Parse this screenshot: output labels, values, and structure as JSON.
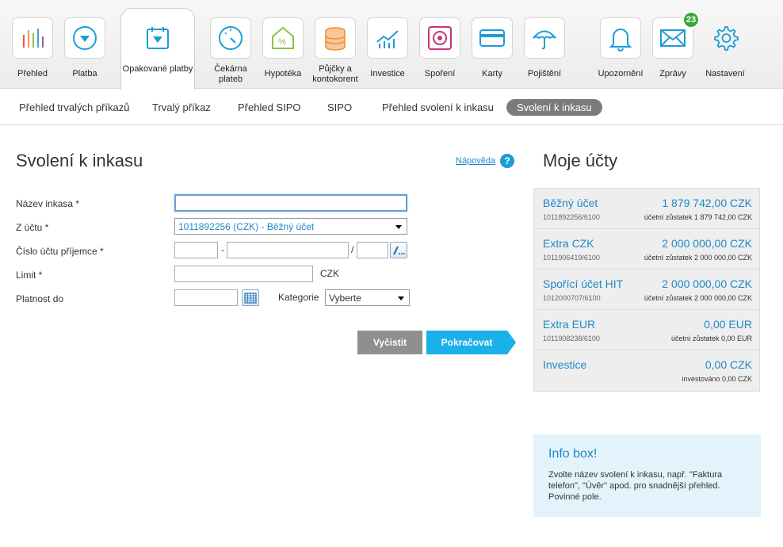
{
  "nav": {
    "items": [
      {
        "label": "Přehled",
        "icon": "bar-chart-icon"
      },
      {
        "label": "Platba",
        "icon": "payment-icon"
      },
      {
        "label": "Opakované platby",
        "icon": "recurring-payments-icon"
      },
      {
        "label": "Čekárna plateb",
        "icon": "gauge-icon"
      },
      {
        "label": "Hypotéka",
        "icon": "house-percent-icon"
      },
      {
        "label": "Půjčky a kontokorent",
        "icon": "coins-icon"
      },
      {
        "label": "Investice",
        "icon": "investment-chart-icon"
      },
      {
        "label": "Spoření",
        "icon": "safe-icon"
      },
      {
        "label": "Karty",
        "icon": "card-icon"
      },
      {
        "label": "Pojištění",
        "icon": "umbrella-icon"
      },
      {
        "label": "Upozornění",
        "icon": "bell-icon"
      },
      {
        "label": "Zprávy",
        "icon": "envelope-icon"
      },
      {
        "label": "Nastavení",
        "icon": "gear-icon"
      }
    ],
    "messages_badge": "23"
  },
  "subnav": {
    "items": [
      "Přehled trvalých příkazů",
      "Trvalý příkaz",
      "Přehled SIPO",
      "SIPO",
      "Přehled svolení k inkasu",
      "Svolení k inkasu"
    ]
  },
  "form": {
    "title": "Svolení k inkasu",
    "help_label": "Nápověda",
    "help_icon": "?",
    "fields": {
      "name_label": "Název inkasa *",
      "from_account_label": "Z účtu *",
      "from_account_value": "1011892256 (CZK) - Běžný účet",
      "recipient_label": "Číslo účtu příjemce *",
      "recipient_sep1": "-",
      "recipient_sep2": "/",
      "limit_label": "Limit *",
      "limit_currency": "CZK",
      "valid_until_label": "Platnost do",
      "category_label": "Kategorie",
      "category_value": "Vyberte"
    },
    "buttons": {
      "clear": "Vyčistit",
      "continue": "Pokračovat"
    }
  },
  "accounts": {
    "title": "Moje účty",
    "list": [
      {
        "name": "Běžný účet",
        "number": "1011892256/6100",
        "amount": "1 879 742,00 CZK",
        "balance": "účetní zůstatek 1 879 742,00 CZK"
      },
      {
        "name": "Extra CZK",
        "number": "1011906419/6100",
        "amount": "2 000 000,00 CZK",
        "balance": "účetní zůstatek 2 000 000,00 CZK"
      },
      {
        "name": "Spořící účet HIT",
        "number": "1012000707/6100",
        "amount": "2 000 000,00 CZK",
        "balance": "účetní zůstatek 2 000 000,00 CZK"
      },
      {
        "name": "Extra EUR",
        "number": "1011908238/6100",
        "amount": "0,00 EUR",
        "balance": "účetní zůstatek 0,00 EUR"
      },
      {
        "name": "Investice",
        "number": "",
        "amount": "0,00 CZK",
        "balance": "investováno 0,00 CZK"
      }
    ]
  },
  "infobox": {
    "title": "Info box!",
    "text": "Zvolte název svolení k inkasu, např. \"Faktura telefon\", \"Úvěr\" apod. pro snadnější přehled. Povinné pole."
  },
  "colors": {
    "accent": "#1e88c7",
    "button_blue": "#1ab0e8",
    "badge_green": "#3aa935",
    "button_grey": "#8f8f8f"
  }
}
